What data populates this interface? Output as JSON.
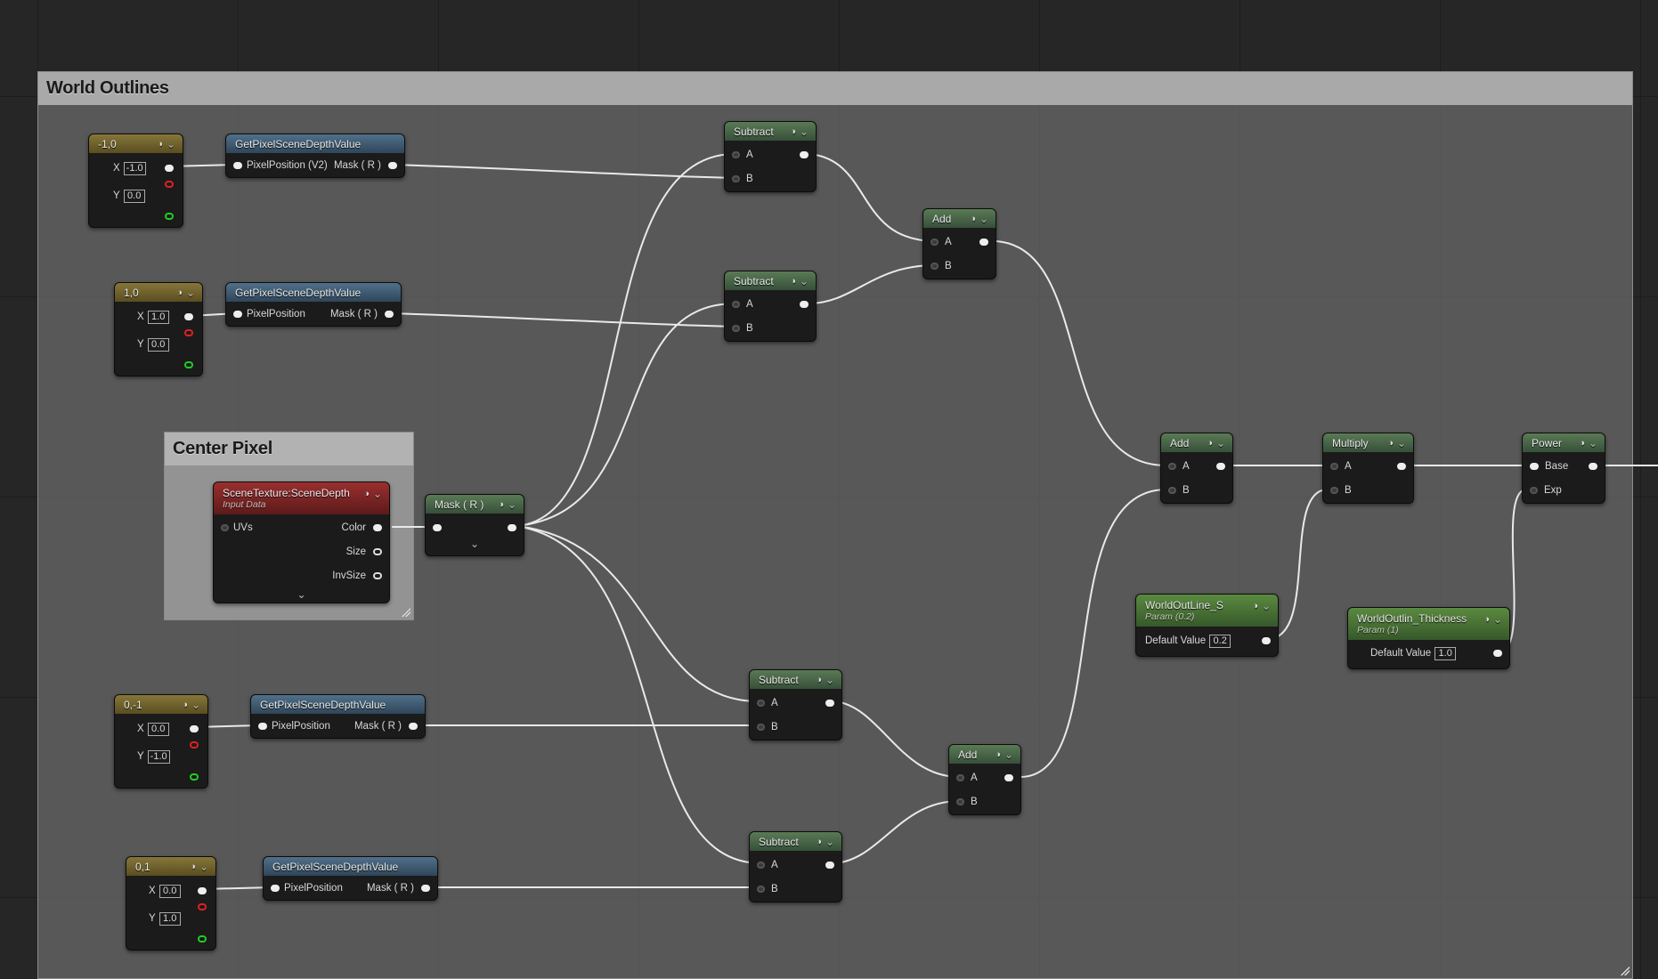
{
  "comments": {
    "world_outlines": "World Outlines",
    "center_pixel": "Center Pixel"
  },
  "constants": [
    {
      "title": "-1,0",
      "x": "-1.0",
      "y": "0.0"
    },
    {
      "title": "1,0",
      "x": "1.0",
      "y": "0.0"
    },
    {
      "title": "0,-1",
      "x": "0.0",
      "y": "-1.0"
    },
    {
      "title": "0,1",
      "x": "0.0",
      "y": "1.0"
    }
  ],
  "pin_labels": {
    "x": "X",
    "y": "Y",
    "a": "A",
    "b": "B",
    "base": "Base",
    "exp": "Exp",
    "pixel_position_v2": "PixelPosition (V2)",
    "pixel_position": "PixelPosition",
    "mask_r": "Mask ( R )",
    "uvs": "UVs",
    "color": "Color",
    "size": "Size",
    "invsize": "InvSize",
    "default_value": "Default Value"
  },
  "depth_node_title": "GetPixelSceneDepthValue",
  "scene_texture": {
    "title": "SceneTexture:SceneDepth",
    "subtitle": "Input Data"
  },
  "mask_node_title": "Mask ( R )",
  "math": {
    "subtract": "Subtract",
    "add": "Add",
    "multiply": "Multiply",
    "power": "Power"
  },
  "params": [
    {
      "title": "WorldOutLine_S",
      "subtitle": "Param (0.2)",
      "value": "0.2"
    },
    {
      "title": "WorldOutlin_Thickness",
      "subtitle": "Param (1)",
      "value": "1.0"
    }
  ],
  "icons": {
    "preview": "preview-toggle-icon",
    "collapse": "collapse-chevron-icon"
  }
}
